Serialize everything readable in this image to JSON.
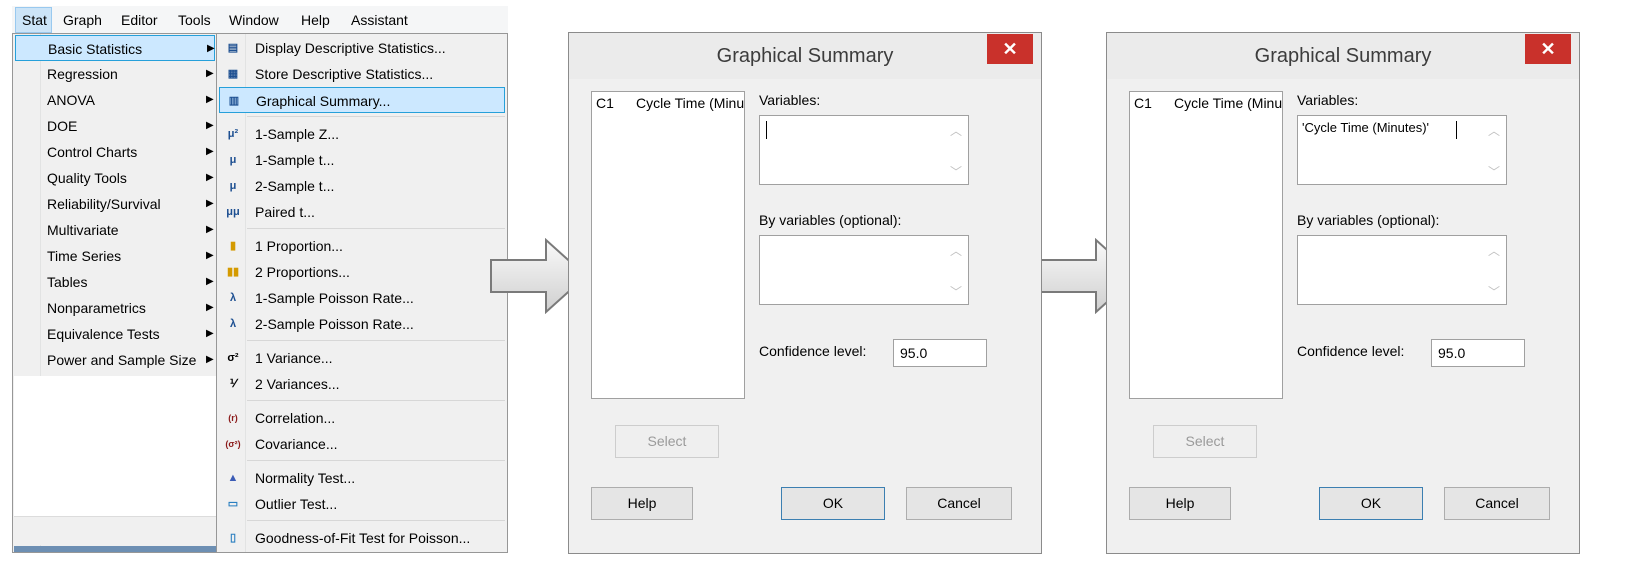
{
  "menubar": {
    "items": [
      "Stat",
      "Graph",
      "Editor",
      "Tools",
      "Window",
      "Help",
      "Assistant"
    ],
    "active": "Stat"
  },
  "stat_menu": {
    "items": [
      "Basic Statistics",
      "Regression",
      "ANOVA",
      "DOE",
      "Control Charts",
      "Quality Tools",
      "Reliability/Survival",
      "Multivariate",
      "Time Series",
      "Tables",
      "Nonparametrics",
      "Equivalence Tests",
      "Power and Sample Size"
    ],
    "highlighted": "Basic Statistics"
  },
  "submenu": {
    "items": [
      {
        "label": "Display Descriptive Statistics...",
        "icon": "descriptive-stats-icon",
        "glyph": "▤"
      },
      {
        "label": "Store Descriptive Statistics...",
        "icon": "store-stats-icon",
        "glyph": "▦"
      },
      {
        "label": "Graphical Summary...",
        "icon": "graphical-summary-icon",
        "glyph": "▥"
      },
      {
        "label": "1-Sample Z...",
        "icon": "mu-squared-icon",
        "glyph": "μ²"
      },
      {
        "label": "1-Sample t...",
        "icon": "mu-icon",
        "glyph": "μ"
      },
      {
        "label": "2-Sample t...",
        "icon": "mu-two-icon",
        "glyph": "μ"
      },
      {
        "label": "Paired t...",
        "icon": "mu-mu-icon",
        "glyph": "μμ"
      },
      {
        "label": "1 Proportion...",
        "icon": "one-proportion-icon",
        "glyph": "▮"
      },
      {
        "label": "2 Proportions...",
        "icon": "two-proportions-icon",
        "glyph": "▮▮"
      },
      {
        "label": "1-Sample Poisson Rate...",
        "icon": "lambda-icon",
        "glyph": "λ"
      },
      {
        "label": "2-Sample Poisson Rate...",
        "icon": "lambda-two-icon",
        "glyph": "λ"
      },
      {
        "label": "1 Variance...",
        "icon": "sigma-squared-icon",
        "glyph": "σ²"
      },
      {
        "label": "2 Variances...",
        "icon": "sigma-ratio-icon",
        "glyph": "⅟"
      },
      {
        "label": "Correlation...",
        "icon": "correlation-icon",
        "glyph": "(r)"
      },
      {
        "label": "Covariance...",
        "icon": "covariance-icon",
        "glyph": "(σ²)"
      },
      {
        "label": "Normality Test...",
        "icon": "normality-test-icon",
        "glyph": "▲"
      },
      {
        "label": "Outlier Test...",
        "icon": "outlier-test-icon",
        "glyph": "▭"
      },
      {
        "label": "Goodness-of-Fit Test for Poisson...",
        "icon": "goodness-of-fit-icon",
        "glyph": "▯"
      }
    ],
    "highlighted": "Graphical Summary..."
  },
  "dialog1": {
    "title": "Graphical Summary",
    "close": "✕",
    "column_id": "C1",
    "column_name": "Cycle Time (Minutes)",
    "variables_label": "Variables:",
    "variables_value": "",
    "by_variables_label": "By variables (optional):",
    "by_variables_value": "",
    "confidence_label": "Confidence level:",
    "confidence_value": "95.0",
    "select_button": "Select",
    "help_button": "Help",
    "ok_button": "OK",
    "cancel_button": "Cancel"
  },
  "dialog2": {
    "title": "Graphical Summary",
    "close": "✕",
    "column_id": "C1",
    "column_name": "Cycle Time (Minutes)",
    "variables_label": "Variables:",
    "variables_value": "'Cycle Time (Minutes)'",
    "by_variables_label": "By variables (optional):",
    "by_variables_value": "",
    "confidence_label": "Confidence level:",
    "confidence_value": "95.0",
    "select_button": "Select",
    "help_button": "Help",
    "ok_button": "OK",
    "cancel_button": "Cancel"
  },
  "colors": {
    "menu_highlight": "#cce8ff",
    "menu_highlight_border": "#26a0da",
    "close_button": "#c9312b",
    "dialog_bg": "#f0f0f0"
  }
}
